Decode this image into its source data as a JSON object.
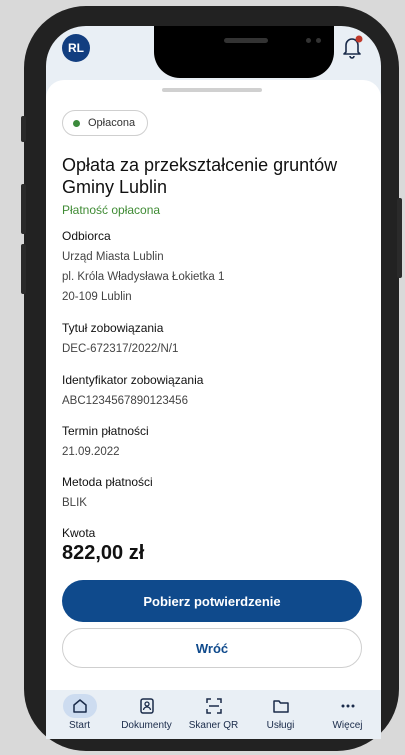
{
  "header": {
    "avatar_initials": "RL",
    "notification_dot_color": "#c0392b"
  },
  "payment": {
    "status_badge": "Opłacona",
    "title": "Opłata za przekształcenie gruntów Gminy Lublin",
    "status_text": "Płatność opłacona",
    "recipient_label": "Odbiorca",
    "recipient_name": "Urząd Miasta Lublin",
    "recipient_street": "pl. Króla Władysława Łokietka 1",
    "recipient_city": "20-109 Lublin",
    "obligation_title_label": "Tytuł zobowiązania",
    "obligation_title_value": "DEC-672317/2022/N/1",
    "obligation_id_label": "Identyfikator zobowiązania",
    "obligation_id_value": "ABC1234567890123456",
    "due_date_label": "Termin płatności",
    "due_date_value": "21.09.2022",
    "method_label": "Metoda płatności",
    "method_value": "BLIK",
    "amount_label": "Kwota",
    "amount_value": "822,00 zł"
  },
  "actions": {
    "download_label": "Pobierz potwierdzenie",
    "back_label": "Wróć"
  },
  "navbar": {
    "items": [
      {
        "label": "Start",
        "icon": "home-icon",
        "active": true
      },
      {
        "label": "Dokumenty",
        "icon": "documents-icon",
        "active": false
      },
      {
        "label": "Skaner QR",
        "icon": "qr-scanner-icon",
        "active": false
      },
      {
        "label": "Usługi",
        "icon": "folder-icon",
        "active": false
      },
      {
        "label": "Więcej",
        "icon": "more-icon",
        "active": false
      }
    ]
  },
  "colors": {
    "primary": "#0f4a8c",
    "paid_green": "#3f8b34"
  }
}
